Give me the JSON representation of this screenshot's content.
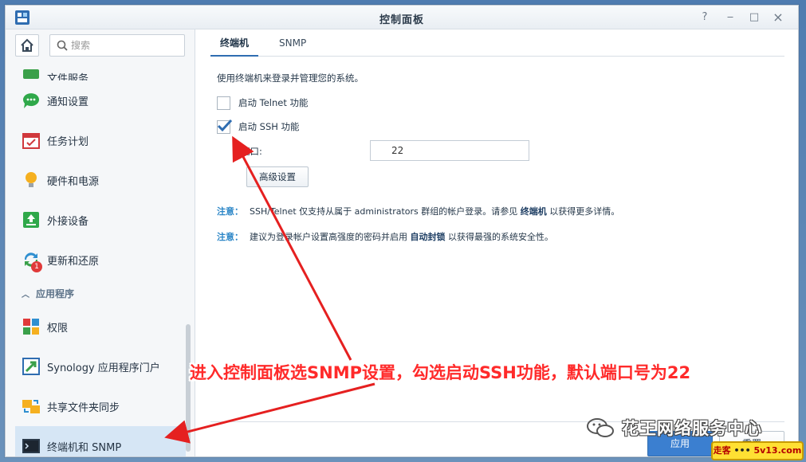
{
  "window": {
    "title": "控制面板"
  },
  "titlebar_buttons": [
    "?",
    "‒",
    "□",
    "×"
  ],
  "search": {
    "placeholder": "搜索"
  },
  "sidebar": {
    "items": [
      {
        "label": "文件服务",
        "icon": "file-services-icon"
      },
      {
        "label": "通知设置",
        "icon": "notification-icon"
      },
      {
        "label": "任务计划",
        "icon": "calendar-icon"
      },
      {
        "label": "硬件和电源",
        "icon": "lightbulb-icon"
      },
      {
        "label": "外接设备",
        "icon": "external-device-icon"
      },
      {
        "label": "更新和还原",
        "icon": "update-icon",
        "badge": "1"
      }
    ],
    "section": {
      "label": "应用程序"
    },
    "app_items": [
      {
        "label": "权限",
        "icon": "privileges-icon"
      },
      {
        "label": "Synology 应用程序门户",
        "icon": "app-portal-icon"
      },
      {
        "label": "共享文件夹同步",
        "icon": "folder-sync-icon"
      },
      {
        "label": "终端机和 SNMP",
        "icon": "terminal-icon",
        "active": true
      }
    ]
  },
  "tabs": [
    {
      "label": "终端机",
      "active": true
    },
    {
      "label": "SNMP",
      "active": false
    }
  ],
  "content": {
    "description": "使用终端机来登录并管理您的系统。",
    "telnet": {
      "label": "启动 Telnet 功能",
      "checked": false
    },
    "ssh": {
      "label": "启动 SSH 功能",
      "checked": true
    },
    "port": {
      "label": "端口:",
      "value": "22"
    },
    "advanced_button": "高级设置",
    "note1": {
      "label": "注意：",
      "text": "SSH/Telnet 仅支持从属于 administrators 群组的帐户登录。请参见",
      "link": "终端机",
      "suffix": "以获得更多详情。"
    },
    "note2": {
      "label": "注意：",
      "text": "建议为登录帐户设置高强度的密码并启用",
      "link": "自动封锁",
      "suffix": "以获得最强的系统安全性。"
    }
  },
  "footer": {
    "apply": "应用",
    "reset": "重置"
  },
  "annotation": {
    "text": "进入控制面板选SNMP设置，勾选启动SSH功能，默认端口号为22",
    "color": "#ff2a2a"
  },
  "watermark": {
    "text": "花王网络服务中心",
    "badge_left": "走客",
    "badge_dots": "•••",
    "badge_right": "5v13.com"
  },
  "colors": {
    "accent": "#3b7fd0",
    "active_nav": "#d6e6f5",
    "note_label": "#2b86c7"
  }
}
